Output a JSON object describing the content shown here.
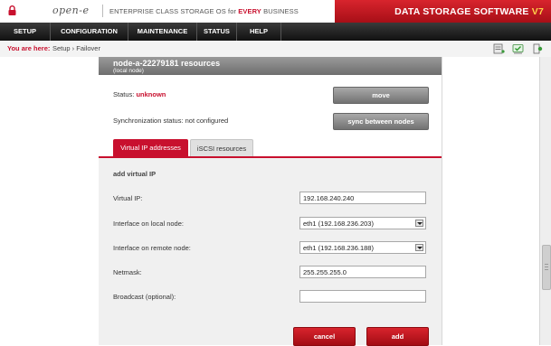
{
  "brand": {
    "logo": "open-e",
    "tagline_parts": [
      "ENTERPRISE CLASS STORAGE OS for ",
      "EVERY",
      " BUSINESS"
    ],
    "product_title": "DATA STORAGE SOFTWARE",
    "version": "V7"
  },
  "nav": [
    "SETUP",
    "CONFIGURATION",
    "MAINTENANCE",
    "STATUS",
    "HELP"
  ],
  "breadcrumb": {
    "label": "You are here:",
    "path": "Setup › Failover"
  },
  "toolbar_icons": [
    "server-icon",
    "checkmark-icon",
    "exit-icon"
  ],
  "section": {
    "title": "node-a-22279181 resources",
    "subtitle": "(local node)"
  },
  "status": {
    "label": "Status:",
    "value": "unknown",
    "sync_label": "Synchronization status: not configured"
  },
  "buttons": {
    "move": "move",
    "sync": "sync between nodes",
    "cancel": "cancel",
    "add": "add"
  },
  "tabs": [
    "Virtual IP addresses",
    "iSCSI resources"
  ],
  "form": {
    "heading": "add virtual IP",
    "fields": [
      {
        "label": "Virtual IP:",
        "value": "192.168.240.240"
      },
      {
        "label": "Interface on local node:",
        "value": "eth1 (192.168.236.203)"
      },
      {
        "label": "Interface on remote node:",
        "value": "eth1 (192.168.236.188)"
      },
      {
        "label": "Netmask:",
        "value": "255.255.255.0"
      },
      {
        "label": "Broadcast (optional):",
        "value": ""
      }
    ]
  },
  "colors": {
    "accent_red": "#c8102e",
    "nav_bg": "#1e1e1e",
    "header_gray": "#808080",
    "version_yellow": "#ffd24a"
  }
}
